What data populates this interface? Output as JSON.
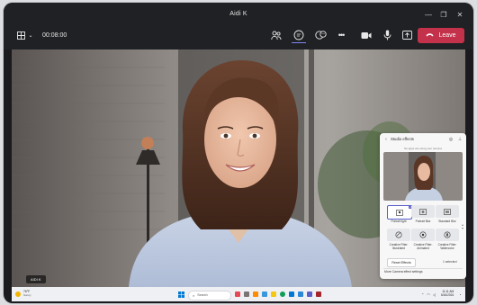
{
  "window": {
    "title": "Aidi K"
  },
  "meeting": {
    "timer": "00:08:00",
    "leave_label": "Leave",
    "participant_name": "AIDI K"
  },
  "studio_panel": {
    "title": "Studio effects",
    "subtitle": "No apps are using your camera",
    "effects": [
      {
        "label": "Portrait light",
        "selected": true
      },
      {
        "label": "Portrait Blur",
        "selected": false
      },
      {
        "label": "Standard Blur",
        "selected": false
      },
      {
        "label": "Creative Filter: Illustrated",
        "selected": false
      },
      {
        "label": "Creative Filter: Animated",
        "selected": false
      },
      {
        "label": "Creative Filter: Watercolor",
        "selected": false
      }
    ],
    "reset_label": "Reset Effects",
    "status_label": "1 selected",
    "more_link": "More Camera effect settings"
  },
  "taskbar": {
    "weather_temp": "76°F",
    "weather_desc": "Sunny",
    "search_placeholder": "Search",
    "time": "11:11 AM",
    "date": "6/16/2024"
  },
  "colors": {
    "leave": "#c4314b",
    "accent": "#5b5fc7",
    "titlebar": "#202124"
  }
}
